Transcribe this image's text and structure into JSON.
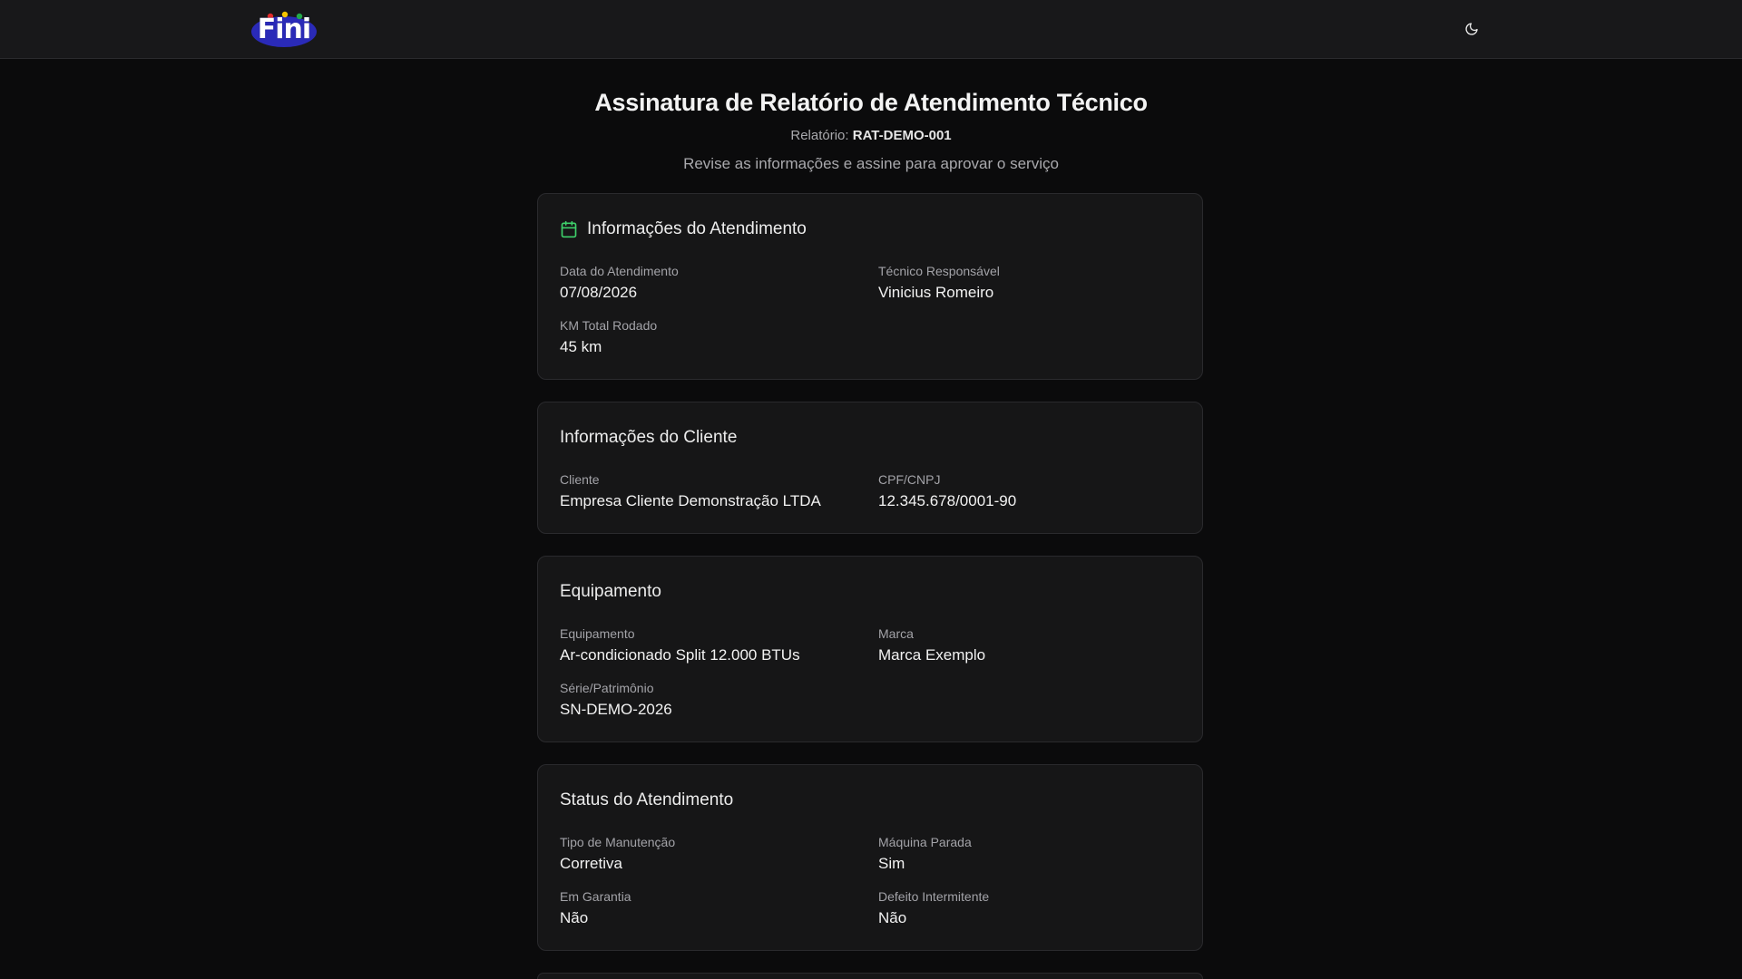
{
  "app": {
    "logo_text": "Fini",
    "logo_colors": [
      "#2a2ab8",
      "#e02a2a",
      "#f5c400",
      "#23a94a"
    ],
    "theme_toggle_icon": "moon-icon"
  },
  "header": {
    "title": "Assinatura de Relatório de Atendimento Técnico",
    "report_label": "Relatório:",
    "report_code": "RAT-DEMO-001",
    "subtitle": "Revise as informações e assine para aprovar o serviço"
  },
  "cards": {
    "atendimento": {
      "icon": "calendar-icon",
      "icon_color": "#3ecf6a",
      "title": "Informações do Atendimento",
      "fields": [
        {
          "label": "Data do Atendimento",
          "value": "07/08/2026"
        },
        {
          "label": "Técnico Responsável",
          "value": "Vinicius Romeiro"
        },
        {
          "label": "KM Total Rodado",
          "value": "45 km"
        }
      ]
    },
    "cliente": {
      "title": "Informações do Cliente",
      "fields": [
        {
          "label": "Cliente",
          "value": "Empresa Cliente Demonstração LTDA"
        },
        {
          "label": "CPF/CNPJ",
          "value": "12.345.678/0001-90"
        }
      ]
    },
    "equipamento": {
      "title": "Equipamento",
      "fields": [
        {
          "label": "Equipamento",
          "value": "Ar-condicionado Split 12.000 BTUs"
        },
        {
          "label": "Marca",
          "value": "Marca Exemplo"
        },
        {
          "label": "Série/Patrimônio",
          "value": "SN-DEMO-2026"
        }
      ]
    },
    "status": {
      "title": "Status do Atendimento",
      "fields": [
        {
          "label": "Tipo de Manutenção",
          "value": "Corretiva"
        },
        {
          "label": "Máquina Parada",
          "value": "Sim"
        },
        {
          "label": "Em Garantia",
          "value": "Não"
        },
        {
          "label": "Defeito Intermitente",
          "value": "Não"
        }
      ]
    }
  }
}
